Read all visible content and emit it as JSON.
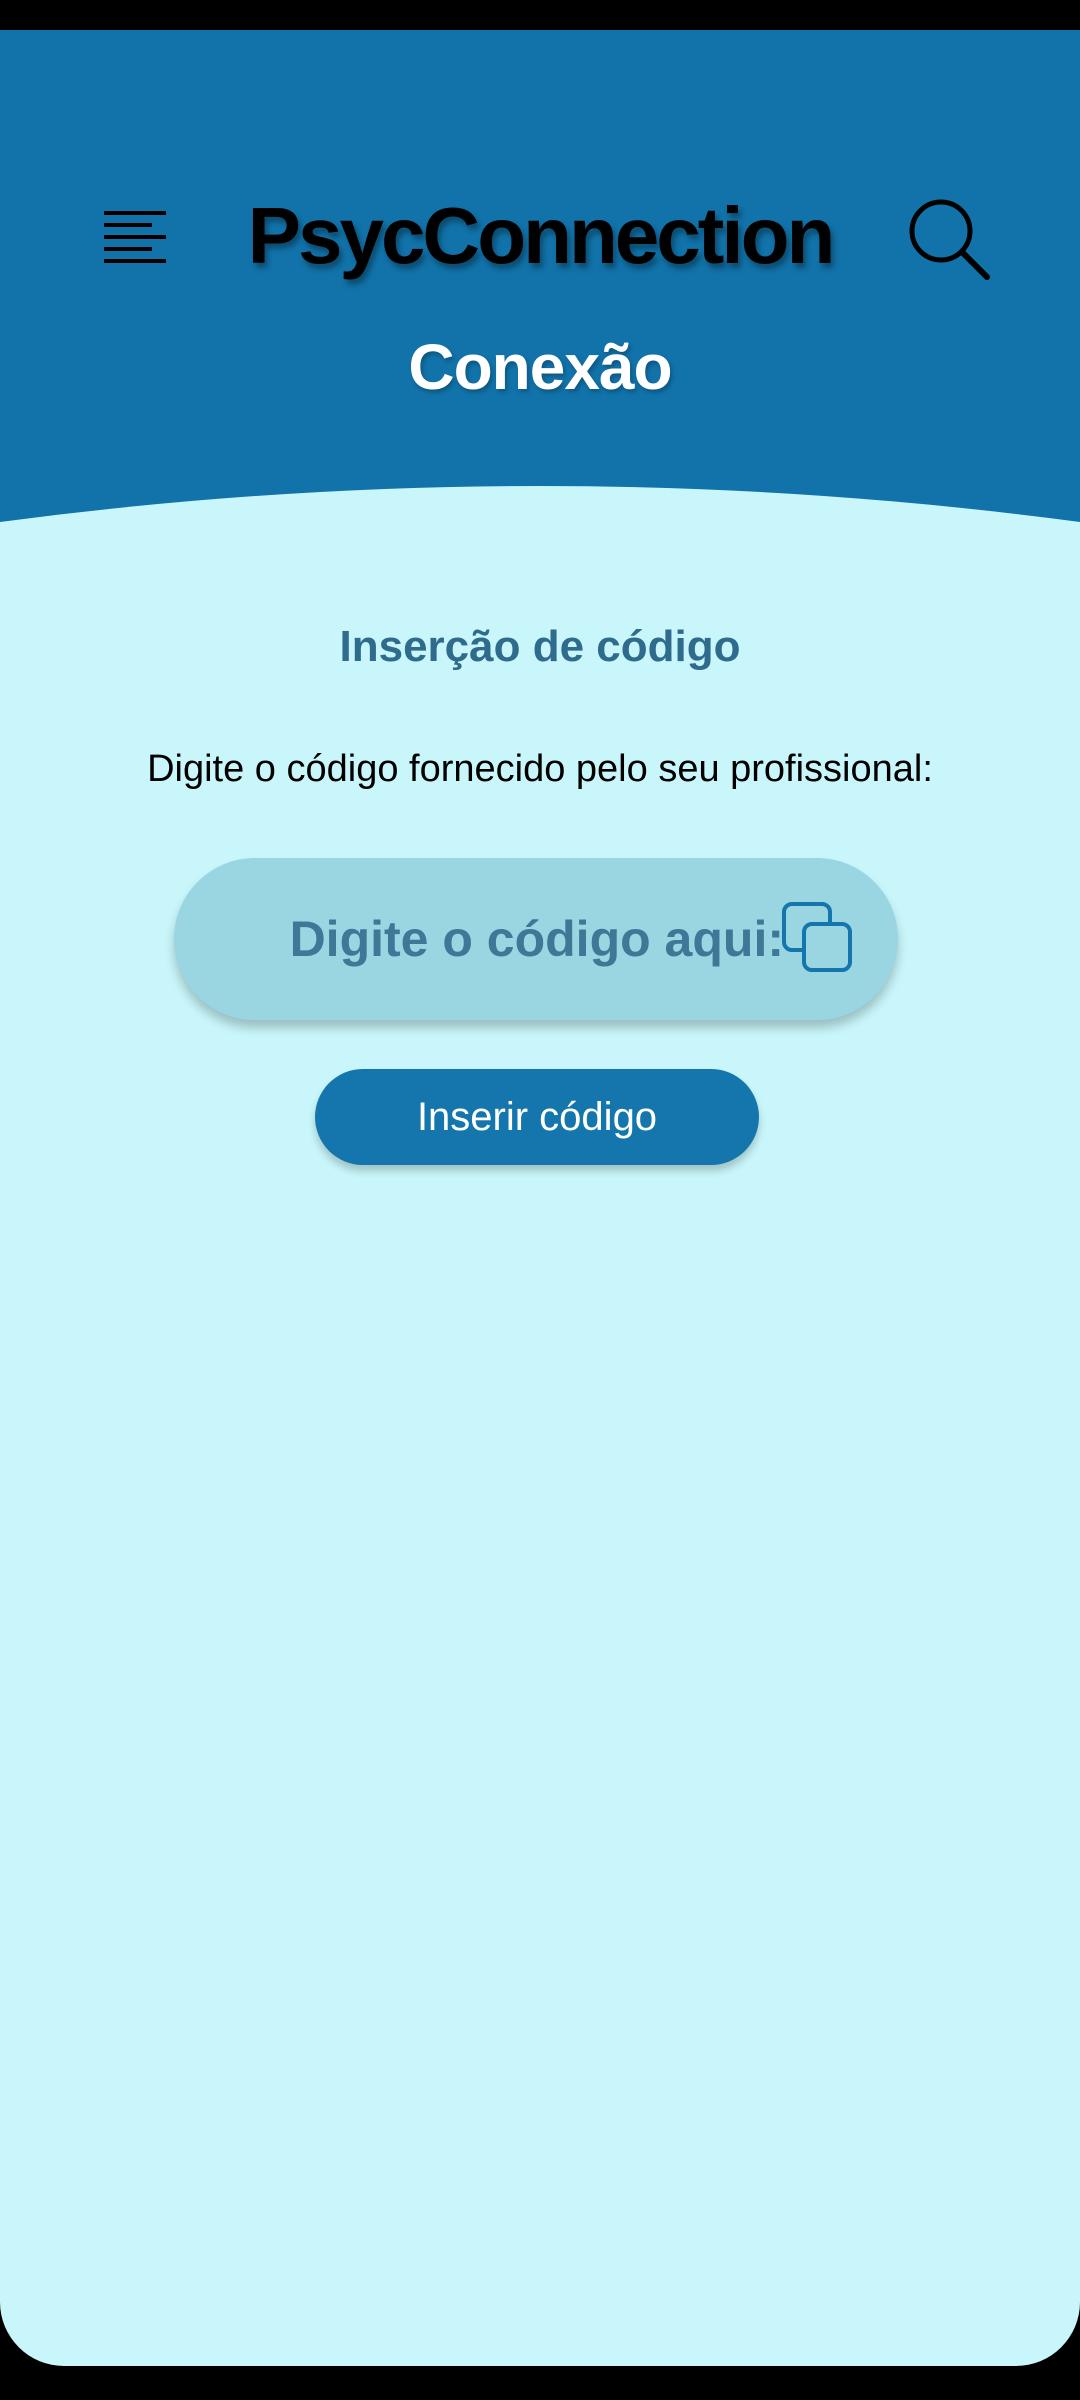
{
  "app": {
    "title": "PsycConnection",
    "screen_title": "Conexão"
  },
  "header": {
    "menu_icon": "menu-icon",
    "search_icon": "search-icon"
  },
  "content": {
    "section_title": "Inserção de código",
    "instruction": "Digite o código fornecido pelo seu profissional:",
    "code_input": {
      "placeholder": "Digite o código aqui:",
      "value": "",
      "icon": "copy-icon"
    },
    "submit_label": "Inserir código"
  },
  "colors": {
    "header_blue": "#1173aa",
    "background": "#c8f6fa",
    "field": "#9ad6e2",
    "field_text": "#3d7896",
    "section_title": "#2e6b8c",
    "button": "#1476ac"
  }
}
